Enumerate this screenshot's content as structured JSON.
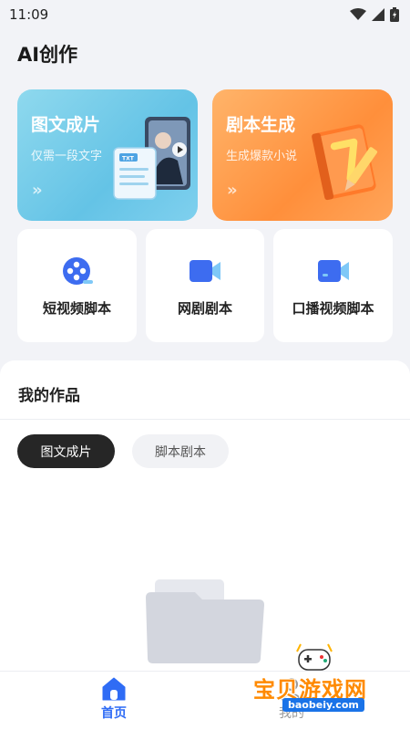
{
  "status_bar": {
    "time": "11:09"
  },
  "page": {
    "title": "AI创作"
  },
  "hero_cards": [
    {
      "title": "图文成片",
      "subtitle": "仅需一段文字",
      "arrow": "»",
      "illus_text": "TXT"
    },
    {
      "title": "剧本生成",
      "subtitle": "生成爆款小说",
      "arrow": "»"
    }
  ],
  "tools": [
    {
      "label": "短视频脚本",
      "icon": "film-reel-icon"
    },
    {
      "label": "网剧剧本",
      "icon": "video-camera-icon"
    },
    {
      "label": "口播视频脚本",
      "icon": "video-camera-icon"
    }
  ],
  "works": {
    "title": "我的作品",
    "tabs": [
      {
        "label": "图文成片",
        "active": true
      },
      {
        "label": "脚本剧本",
        "active": false
      }
    ]
  },
  "tab_bar": {
    "items": [
      {
        "label": "首页",
        "icon": "home-icon",
        "active": true
      },
      {
        "label": "我的",
        "icon": "profile-icon",
        "active": false
      }
    ]
  },
  "watermark": {
    "cn": "宝贝游戏网",
    "en": "baobeiy.com"
  },
  "colors": {
    "accent": "#2f6cf5",
    "hero_left": "#64c3e6",
    "hero_right": "#ff8f3b",
    "active_pill": "#262626"
  }
}
